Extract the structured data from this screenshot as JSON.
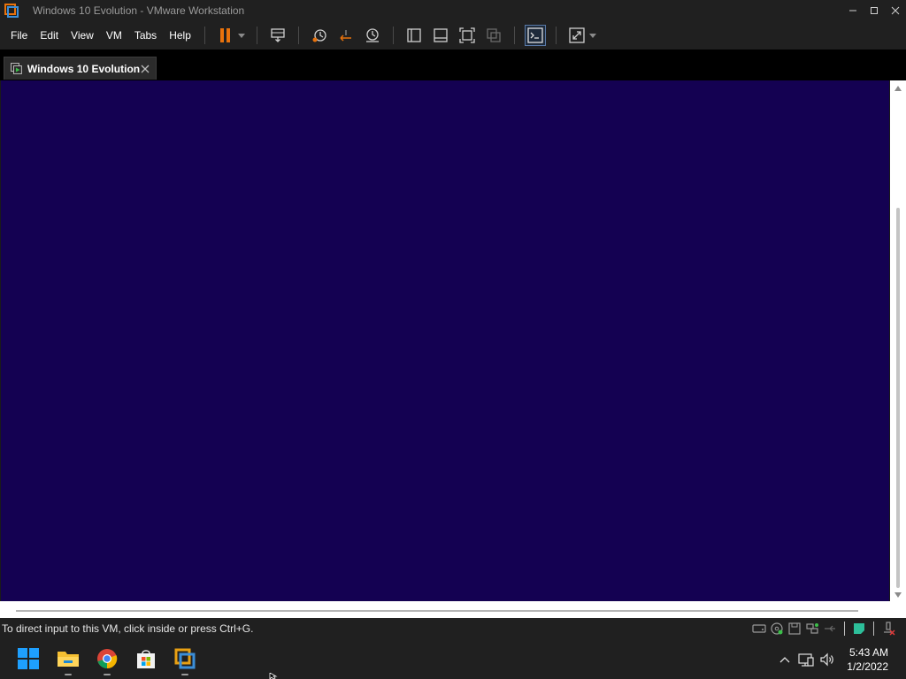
{
  "window": {
    "title": "Windows 10 Evolution - VMware Workstation",
    "controls": [
      "minimize-icon",
      "maximize-icon",
      "close-icon"
    ]
  },
  "menu": {
    "items": [
      "File",
      "Edit",
      "View",
      "VM",
      "Tabs",
      "Help"
    ]
  },
  "toolbar": {
    "buttons": [
      "pause-icon",
      "send-ctrl-alt-del-icon",
      "snapshot-take-icon",
      "snapshot-revert-icon",
      "snapshot-manager-icon",
      "show-library-icon",
      "show-thumbnail-bar-icon",
      "full-screen-icon",
      "unity-icon",
      "console-view-icon",
      "stretch-guest-icon"
    ]
  },
  "tab": {
    "label": "Windows 10 Evolution"
  },
  "vm": {
    "background": "#140152"
  },
  "status": {
    "message": "To direct input to this VM, click inside or press Ctrl+G."
  },
  "taskbar": {
    "apps": [
      "start-icon",
      "file-explorer-icon",
      "chrome-icon",
      "microsoft-store-icon",
      "vmware-workstation-icon"
    ],
    "tray": [
      "show-hidden-icons-icon",
      "network-icon",
      "volume-icon"
    ]
  },
  "clock": {
    "time": "5:43 AM",
    "date": "1/2/2022"
  },
  "colors": {
    "accent_orange": "#e8720c",
    "chrome": "#202020",
    "console": "#140152"
  }
}
